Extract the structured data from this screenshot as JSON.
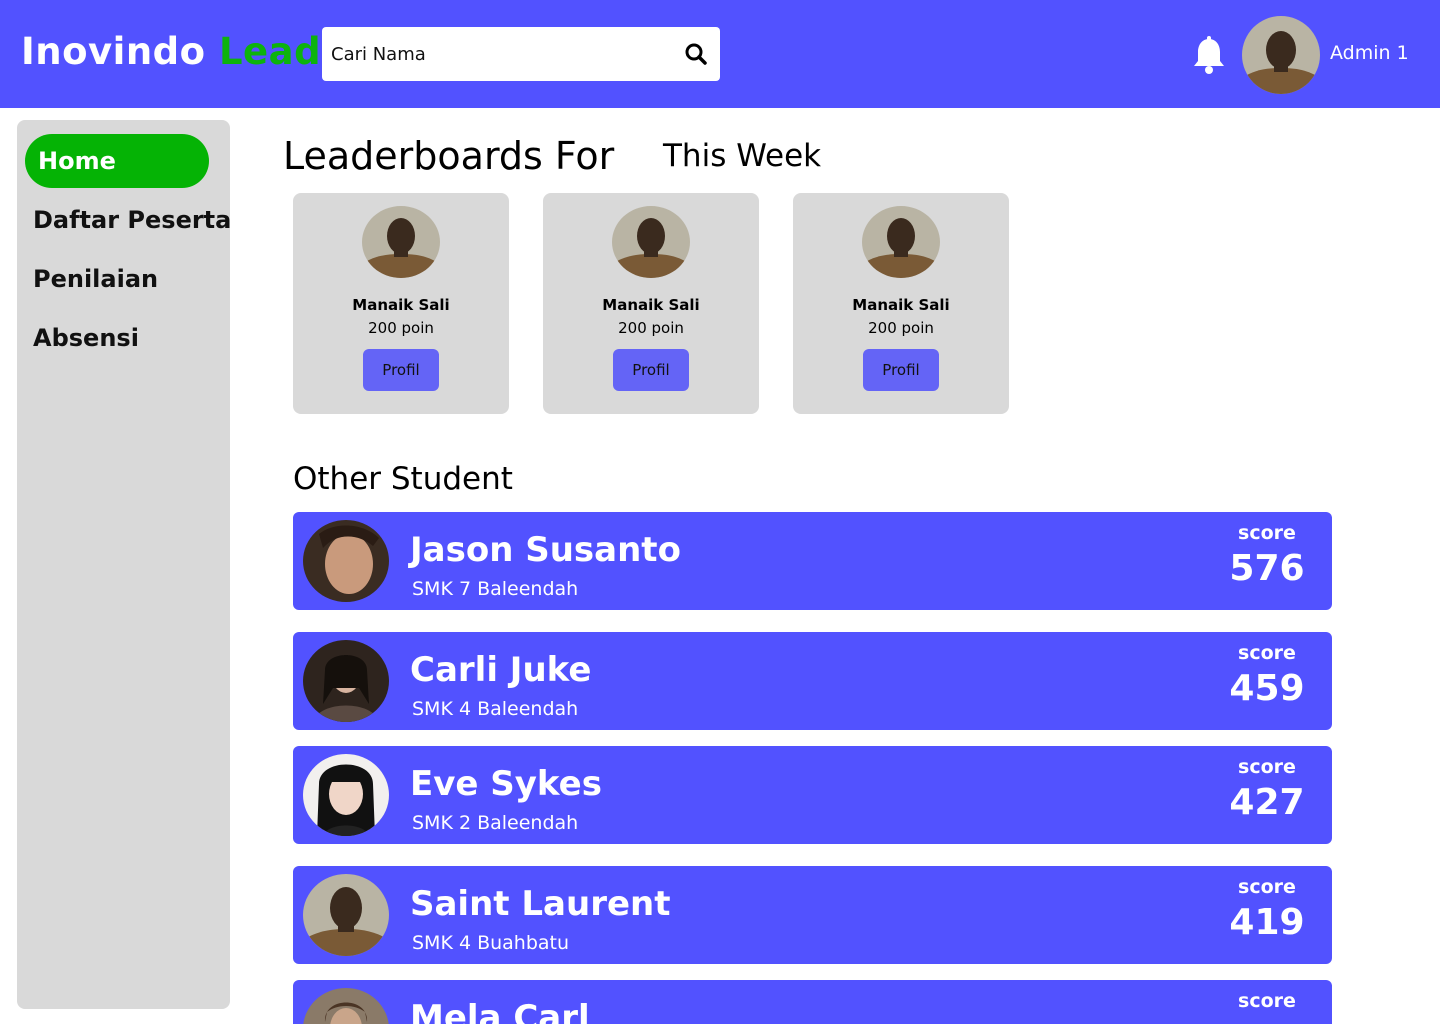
{
  "header": {
    "logo_main": "Inovindo",
    "logo_accent": "Lead",
    "search_placeholder": "Cari Nama",
    "search_icon": "search-icon",
    "bell_icon": "bell-icon",
    "admin_name": "Admin 1"
  },
  "colors": {
    "primary": "#5252ff",
    "accent_green": "#05b305",
    "card_bg": "#d9d9d9",
    "button": "#6464f6"
  },
  "sidebar": {
    "items": [
      {
        "label": "Home",
        "active": true
      },
      {
        "label": "Daftar Peserta",
        "active": false
      },
      {
        "label": "Penilaian",
        "active": false
      },
      {
        "label": "Absensi",
        "active": false
      }
    ]
  },
  "leaderboard": {
    "title": "Leaderboards For",
    "period": "This Week",
    "cards": [
      {
        "name": "Manaik Sali",
        "points": "200 poin",
        "button": "Profil"
      },
      {
        "name": "Manaik Sali",
        "points": "200 poin",
        "button": "Profil"
      },
      {
        "name": "Manaik Sali",
        "points": "200 poin",
        "button": "Profil"
      }
    ]
  },
  "others": {
    "title": "Other Student",
    "score_label": "score",
    "students": [
      {
        "name": "Jason Susanto",
        "school": "SMK 7 Baleendah",
        "score": "576"
      },
      {
        "name": "Carli Juke",
        "school": "SMK 4 Baleendah",
        "score": "459"
      },
      {
        "name": "Eve Sykes",
        "school": "SMK 2 Baleendah",
        "score": "427"
      },
      {
        "name": "Saint Laurent",
        "school": "SMK 4 Buahbatu",
        "score": "419"
      },
      {
        "name": "Mela Carl",
        "school": "",
        "score": ""
      }
    ]
  }
}
